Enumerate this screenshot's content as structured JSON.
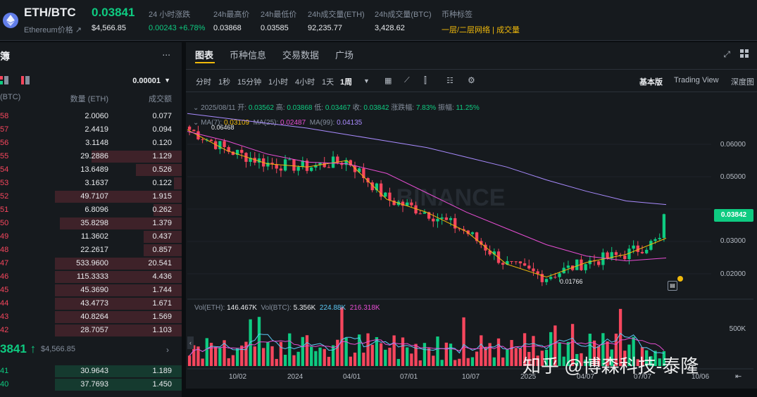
{
  "header": {
    "pair": "ETH/BTC",
    "price": "0.03841",
    "subtitle": "Ethereum价格",
    "usd_price": "$4,566.85",
    "stats": [
      {
        "label": "24 小时涨跌",
        "value": "0.00243 +6.78%"
      },
      {
        "label": "24h最高价",
        "value": "0.03868"
      },
      {
        "label": "24h最低价",
        "value": "0.03585"
      },
      {
        "label": "24h成交量(ETH)",
        "value": "92,235.77"
      },
      {
        "label": "24h成交量(BTC)",
        "value": "3,428.62"
      },
      {
        "label": "币种标签",
        "value": "一层/二层网络 | 成交量"
      }
    ]
  },
  "orderbook": {
    "title": "簿",
    "more": "...",
    "precision": "0.00001",
    "col_price": "(BTC)",
    "col_qty": "数量 (ETH)",
    "col_total": "成交额",
    "asks": [
      {
        "price": "58",
        "qty": "2.0060",
        "total": "0.077",
        "depth": 0
      },
      {
        "price": "57",
        "qty": "2.4419",
        "total": "0.094",
        "depth": 0
      },
      {
        "price": "56",
        "qty": "3.1148",
        "total": "0.120",
        "depth": 0
      },
      {
        "price": "55",
        "qty": "29.2886",
        "total": "1.129",
        "depth": 0.71
      },
      {
        "price": "54",
        "qty": "13.6489",
        "total": "0.526",
        "depth": 0.36
      },
      {
        "price": "53",
        "qty": "3.1637",
        "total": "0.122",
        "depth": 0.06
      },
      {
        "price": "52",
        "qty": "49.7107",
        "total": "1.915",
        "depth": 1.0
      },
      {
        "price": "51",
        "qty": "6.8096",
        "total": "0.262",
        "depth": 0.22
      },
      {
        "price": "50",
        "qty": "35.8298",
        "total": "1.379",
        "depth": 0.96
      },
      {
        "price": "49",
        "qty": "11.3602",
        "total": "0.437",
        "depth": 0.3
      },
      {
        "price": "48",
        "qty": "22.2617",
        "total": "0.857",
        "depth": 0.3
      },
      {
        "price": "47",
        "qty": "533.9600",
        "total": "20.541",
        "depth": 1.0
      },
      {
        "price": "46",
        "qty": "115.3333",
        "total": "4.436",
        "depth": 1.0
      },
      {
        "price": "45",
        "qty": "45.3690",
        "total": "1.744",
        "depth": 1.0
      },
      {
        "price": "44",
        "qty": "43.4773",
        "total": "1.671",
        "depth": 1.0
      },
      {
        "price": "43",
        "qty": "40.8264",
        "total": "1.569",
        "depth": 1.0
      },
      {
        "price": "42",
        "qty": "28.7057",
        "total": "1.103",
        "depth": 1.0
      }
    ],
    "last_price": "3841",
    "last_usd": "$4,566.85",
    "bids": [
      {
        "price": "41",
        "qty": "30.9643",
        "total": "1.189",
        "depth": 1.0
      },
      {
        "price": "40",
        "qty": "37.7693",
        "total": "1.450",
        "depth": 1.0
      }
    ]
  },
  "chart": {
    "tabs": [
      "图表",
      "币种信息",
      "交易数据",
      "广场"
    ],
    "active_tab": "图表",
    "timeframes": [
      "分时",
      "1秒",
      "15分钟",
      "1小时",
      "4小时",
      "1天",
      "1周"
    ],
    "active_timeframe": "1周",
    "views": [
      "基本版",
      "Trading View",
      "深度图"
    ],
    "active_view": "基本版",
    "ohlc": {
      "date": "2025/08/11",
      "open_label": "开:",
      "open": "0.03562",
      "high_label": "高:",
      "high": "0.03868",
      "low_label": "低:",
      "low": "0.03467",
      "close_label": "收:",
      "close": "0.03842",
      "chg_label": "涨跌幅:",
      "chg": "7.83%",
      "amp_label": "振幅:",
      "amp": "11.25%"
    },
    "ma": {
      "ma7_label": "MA(7):",
      "ma7": "0.03109",
      "ma25_label": "MA(25):",
      "ma25": "0.02487",
      "ma99_label": "MA(99):",
      "ma99": "0.04135"
    },
    "vol": {
      "label": "Vol(ETH):",
      "vol_eth": "146.467K",
      "label2": "Vol(BTC):",
      "vol_btc": "5.356K",
      "ma1": "224.88K",
      "ma2": "216.318K"
    },
    "y_ticks": [
      "0.06000",
      "0.05000",
      "0.04000",
      "0.03000",
      "0.02000"
    ],
    "vol_tick": "500K",
    "price_tag": "0.03842",
    "high_marker": "0.06468",
    "low_marker": "0.01766",
    "x_ticks": [
      "10/02",
      "2024",
      "04/01",
      "07/01",
      "10/07",
      "2025",
      "04/07",
      "07/07",
      "10/06"
    ],
    "watermark": "BINANCE",
    "overlay_text": "知乎 @博森科技-泰隆"
  },
  "colors": {
    "up": "#0ecb81",
    "down": "#f6465d",
    "ma7": "#f0b90b",
    "ma25": "#e84ed4",
    "ma99": "#a98bff"
  },
  "chart_data": {
    "type": "candlestick",
    "title": "ETH/BTC 1周",
    "ylim": [
      0.015,
      0.07
    ],
    "x": [
      "10/02",
      "2024",
      "04/01",
      "07/01",
      "10/07",
      "2025",
      "04/07",
      "07/07",
      "10/06"
    ],
    "series": [
      {
        "name": "MA(7)",
        "values": [
          0.0645,
          0.058,
          0.054,
          0.053,
          0.055,
          0.043,
          0.039,
          0.033,
          0.023,
          0.019,
          0.0235,
          0.026,
          0.031
        ]
      },
      {
        "name": "MA(25)",
        "values": [
          0.064,
          0.061,
          0.057,
          0.0545,
          0.054,
          0.051,
          0.045,
          0.039,
          0.034,
          0.029,
          0.0255,
          0.024,
          0.0249
        ]
      },
      {
        "name": "MA(99)",
        "values": [
          0.0695,
          0.068,
          0.0665,
          0.065,
          0.063,
          0.061,
          0.059,
          0.056,
          0.053,
          0.049,
          0.0455,
          0.0425,
          0.0414
        ]
      }
    ],
    "last_close": 0.03842,
    "high": 0.06468,
    "low": 0.01766
  }
}
